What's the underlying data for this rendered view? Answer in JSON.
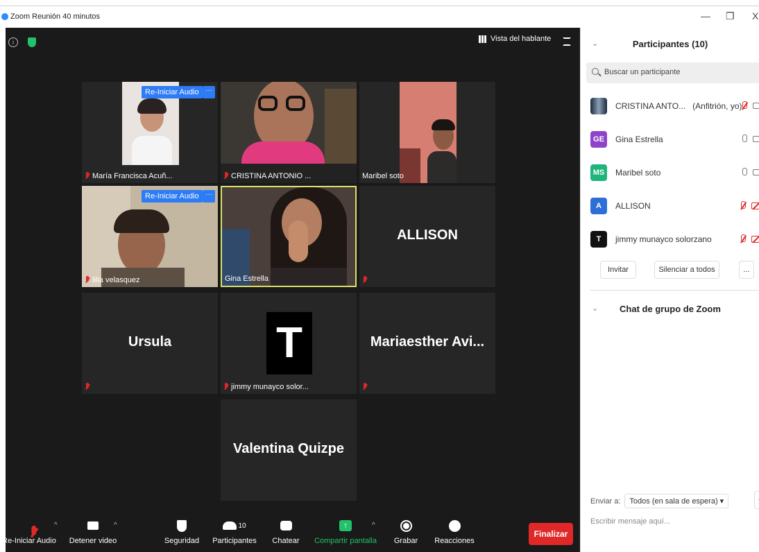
{
  "window": {
    "title": "Zoom Reunión 40 minutos",
    "minimize_glyph": "—",
    "restore_glyph": "❐",
    "close_glyph": "X"
  },
  "meeting": {
    "view_label": "Vista del hablante",
    "restart_audio_label": "Re-Iniciar Audio",
    "more_label": "···",
    "tiles": [
      {
        "name": "María Francisca Acuñ...",
        "muted": true,
        "video": true
      },
      {
        "name": "CRISTINA ANTONIO ...",
        "muted": true,
        "video": true
      },
      {
        "name": "Maribel soto",
        "muted": false,
        "video": true
      },
      {
        "name": "lilia velasquez",
        "muted": true,
        "video": true
      },
      {
        "name": "Gina Estrella",
        "muted": false,
        "video": true,
        "active_speaker": true
      },
      {
        "name": "",
        "big_name": "ALLISON",
        "muted": true,
        "video": false
      },
      {
        "name": "",
        "big_name": "Ursula",
        "muted": true,
        "video": false
      },
      {
        "name": "jimmy munayco solor...",
        "muted": true,
        "video": false,
        "avatar_letter": "T"
      },
      {
        "name": "",
        "big_name": "Mariaesther  Avi...",
        "muted": true,
        "video": false
      },
      {
        "name": "",
        "big_name": "Valentina Quizpe",
        "muted": false,
        "video": false
      }
    ]
  },
  "toolbar": {
    "audio": "Re-Iniciar Audio",
    "video": "Detener video",
    "security": "Seguridad",
    "participants": "Participantes",
    "participants_count": "10",
    "chat": "Chatear",
    "share": "Compartir pantalla",
    "record": "Grabar",
    "reactions": "Reacciones",
    "end": "Finalizar",
    "caret": "^"
  },
  "panel": {
    "title": "Participantes (10)",
    "search_placeholder": "Buscar un participante",
    "participants": [
      {
        "name": "CRISTINA ANTO...",
        "role": "(Anfitrión, yo)",
        "initials": "",
        "color": "#3a5a7a",
        "mic": "off",
        "cam": "on"
      },
      {
        "name": "Gina Estrella",
        "role": "",
        "initials": "GE",
        "color": "#8e44c8",
        "mic": "on",
        "cam": "on"
      },
      {
        "name": "Maribel soto",
        "role": "",
        "initials": "MS",
        "color": "#1fb57a",
        "mic": "on",
        "cam": "on"
      },
      {
        "name": "ALLISON",
        "role": "",
        "initials": "A",
        "color": "#2d6fd6",
        "mic": "off",
        "cam": "off"
      },
      {
        "name": "jimmy munayco solorzano",
        "role": "",
        "initials": "T",
        "color": "#111111",
        "mic": "off",
        "cam": "off"
      }
    ],
    "invite": "Invitar",
    "mute_all": "Silenciar a todos",
    "more": "...",
    "chat_title": "Chat de grupo de Zoom",
    "send_to_label": "Enviar a:",
    "send_to_value": "Todos (en sala de espera)",
    "chat_placeholder": "Escribir mensaje aquí..."
  }
}
